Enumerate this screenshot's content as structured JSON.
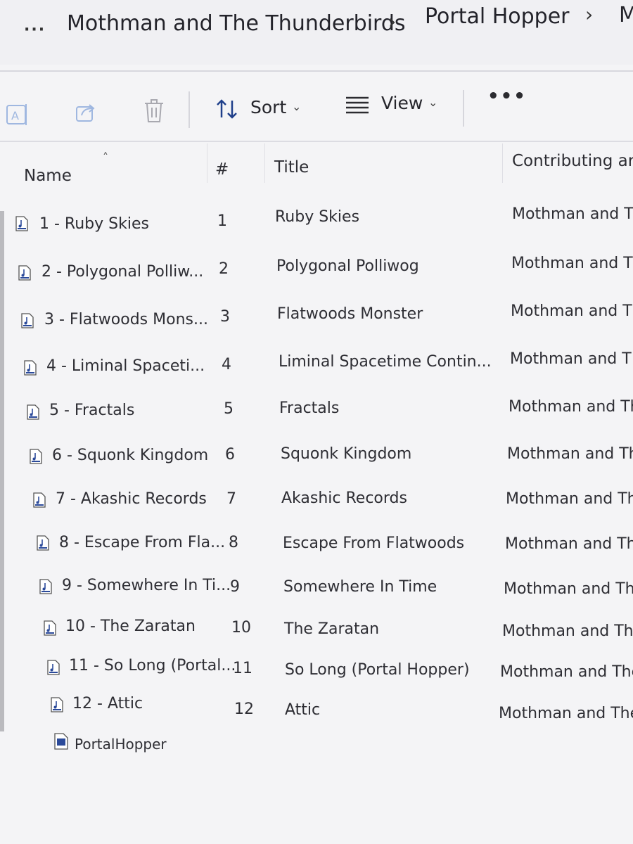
{
  "breadcrumb": {
    "more": "···",
    "items": [
      "Mothman and The Thunderbirds",
      "Portal Hopper",
      "M"
    ]
  },
  "toolbar": {
    "sort_label": "Sort",
    "view_label": "View",
    "more": "•••"
  },
  "columns": {
    "name": "Name",
    "number": "#",
    "title": "Title",
    "contributing": "Contributing ar"
  },
  "rows": [
    {
      "name": "1 - Ruby Skies",
      "num": "1",
      "title": "Ruby Skies",
      "artist": "Mothman and T"
    },
    {
      "name": "2 - Polygonal Polliw...",
      "num": "2",
      "title": "Polygonal Polliwog",
      "artist": "Mothman and T"
    },
    {
      "name": "3 - Flatwoods Mons...",
      "num": "3",
      "title": "Flatwoods Monster",
      "artist": "Mothman and T"
    },
    {
      "name": "4 - Liminal Spaceti...",
      "num": "4",
      "title": "Liminal Spacetime Contin...",
      "artist": "Mothman and T"
    },
    {
      "name": "5 - Fractals",
      "num": "5",
      "title": "Fractals",
      "artist": "Mothman and Th"
    },
    {
      "name": "6 - Squonk Kingdom",
      "num": "6",
      "title": "Squonk Kingdom",
      "artist": "Mothman and Th"
    },
    {
      "name": "7 - Akashic Records",
      "num": "7",
      "title": "Akashic Records",
      "artist": "Mothman and Th"
    },
    {
      "name": "8 - Escape From Fla...",
      "num": "8",
      "title": "Escape From Flatwoods",
      "artist": "Mothman and The"
    },
    {
      "name": "9 - Somewhere In Ti...",
      "num": "9",
      "title": "Somewhere In Time",
      "artist": "Mothman and The"
    },
    {
      "name": "10 - The Zaratan",
      "num": "10",
      "title": "The Zaratan",
      "artist": "Mothman and The"
    },
    {
      "name": "11 - So Long (Portal...",
      "num": "11",
      "title": "So Long (Portal Hopper)",
      "artist": "Mothman and The"
    },
    {
      "name": "12 - Attic",
      "num": "12",
      "title": "Attic",
      "artist": "Mothman and The"
    }
  ],
  "extra_file": {
    "name": "PortalHopper"
  },
  "icons": {
    "rename": "rename-icon",
    "share": "share-icon",
    "delete": "trash-icon",
    "sort": "sort-arrows-icon",
    "view": "view-lines-icon",
    "audio": "music-file-icon",
    "image": "image-file-icon"
  }
}
